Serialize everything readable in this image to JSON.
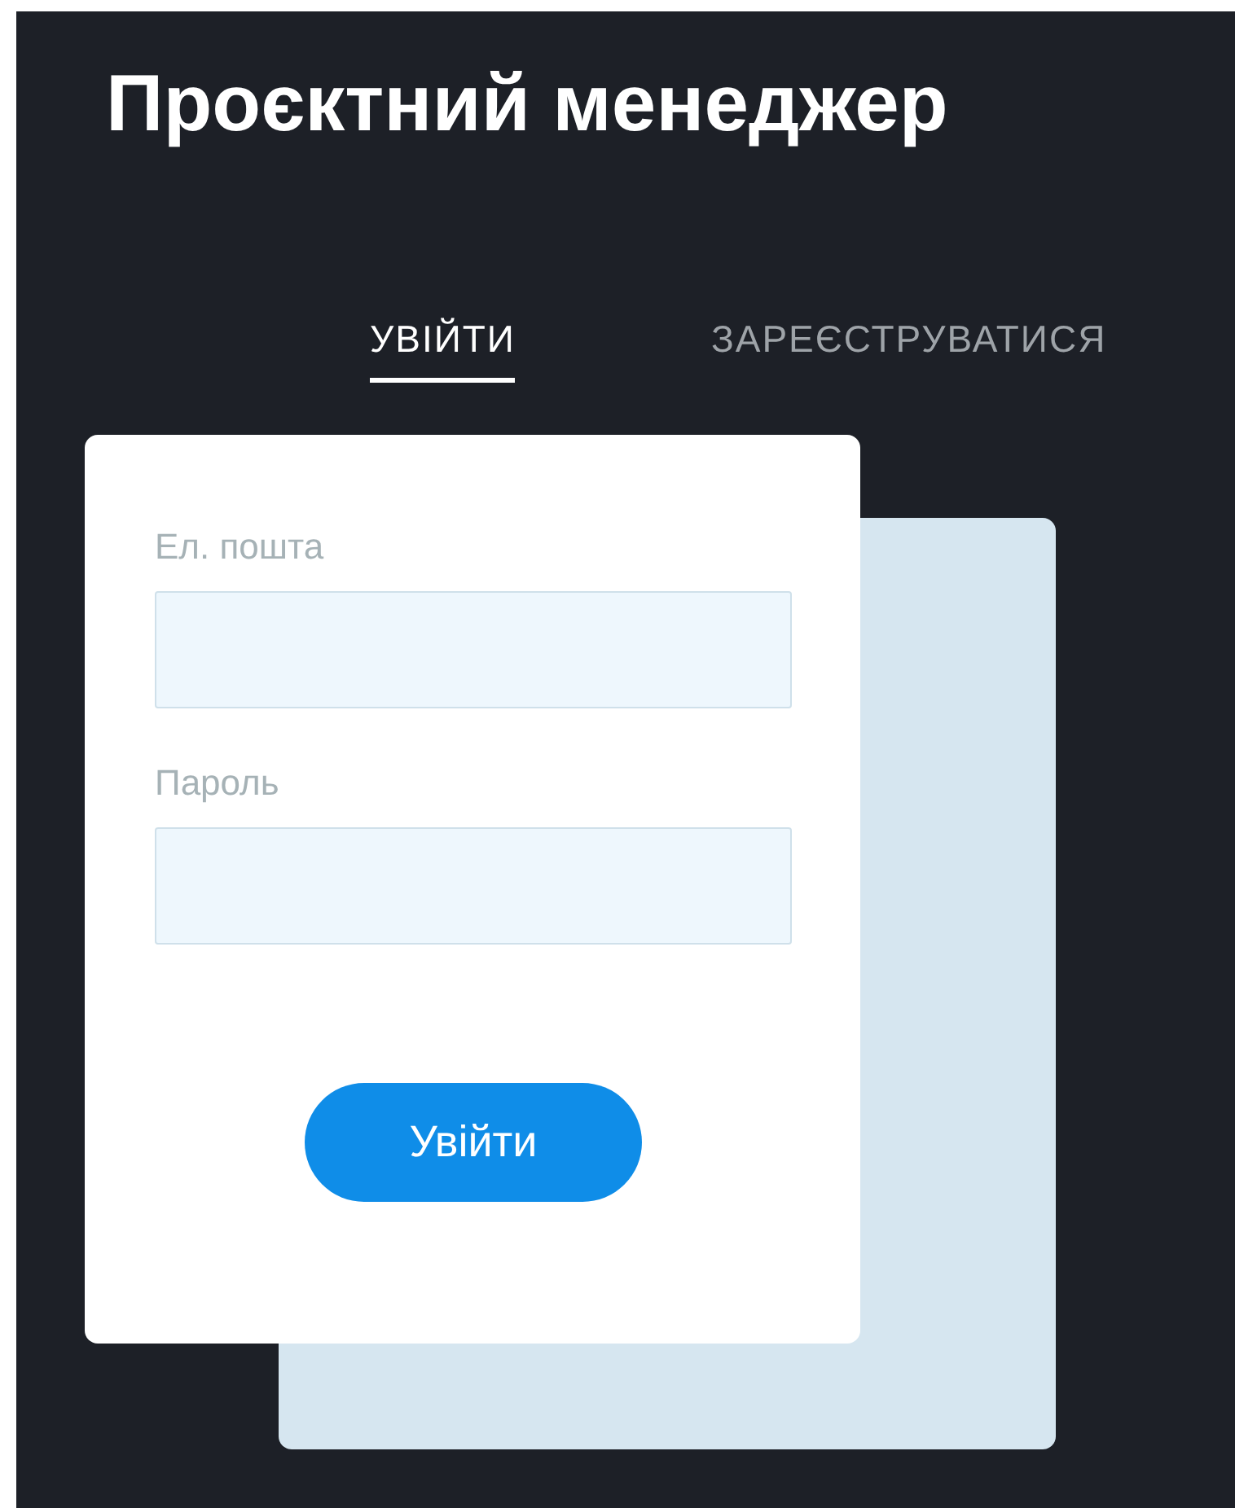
{
  "title": "Проєктний менеджер",
  "tabs": [
    {
      "label": "УВІЙТИ",
      "selected": true
    },
    {
      "label": "ЗАРЕЄСТРУВАТИСЯ",
      "selected": false
    }
  ],
  "form": {
    "fields": [
      {
        "label": "Ел. пошта"
      },
      {
        "label": "Пароль"
      }
    ],
    "submit": "Увійти"
  }
}
